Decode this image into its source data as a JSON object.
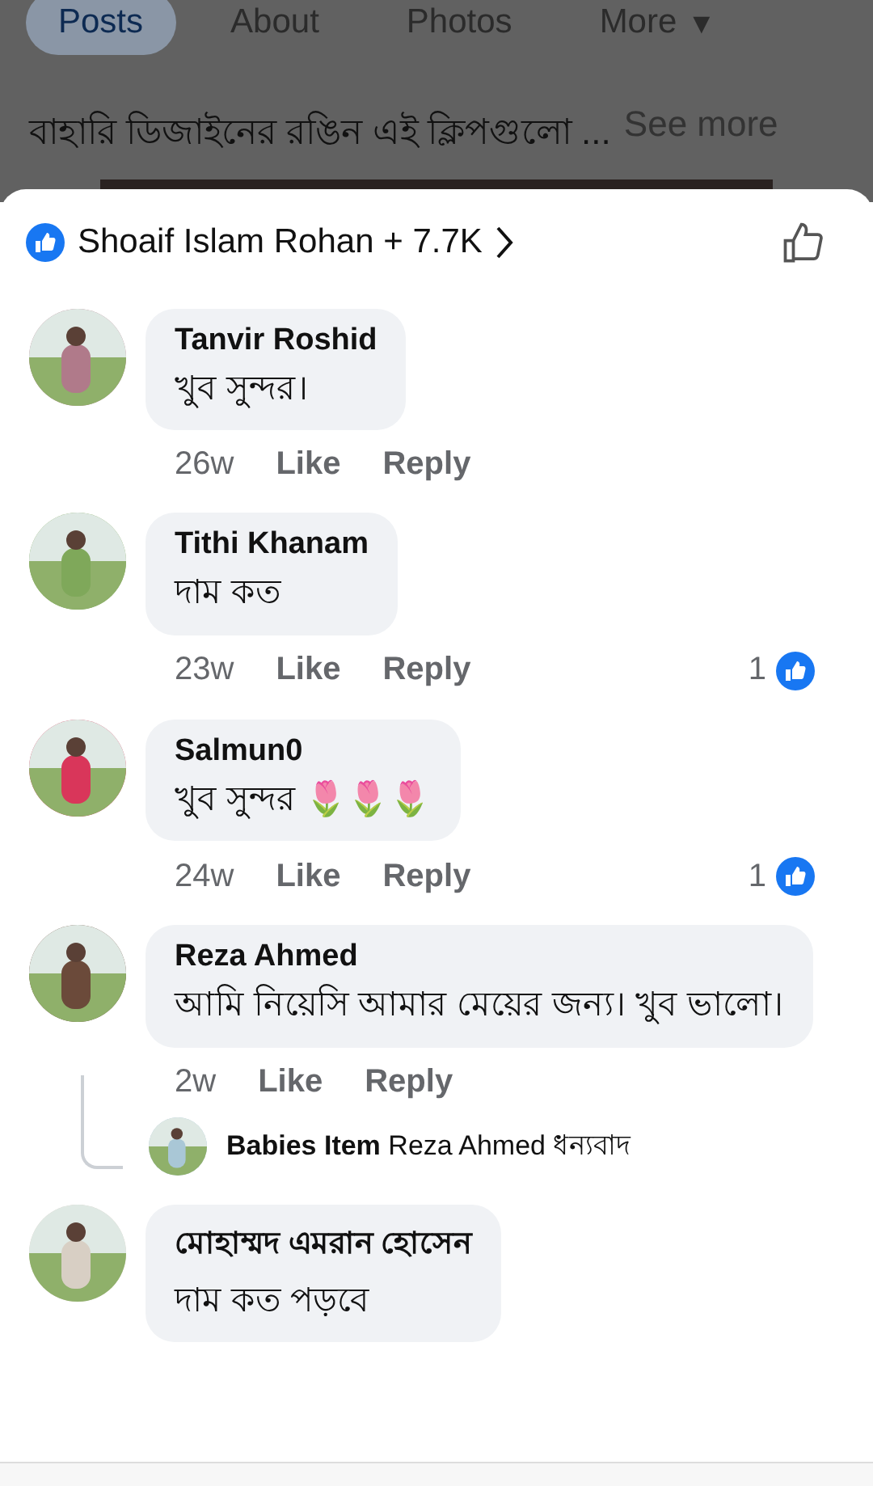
{
  "page_tabs": [
    {
      "label": "Posts",
      "selected": true
    },
    {
      "label": "About",
      "selected": false
    },
    {
      "label": "Photos",
      "selected": false
    },
    {
      "label": "More",
      "selected": false,
      "caret": "▾"
    }
  ],
  "post_text": "বাহারি ডিজাইনের রঙিন এই ক্লিপগুলো ...",
  "see_more": "See more",
  "reactions_header": {
    "summary": "Shoaif Islam Rohan + 7.7K"
  },
  "comments": [
    {
      "name": "Tanvir Roshid",
      "text": "খুব সুন্দর।",
      "time": "26w",
      "like": "Like",
      "reply": "Reply"
    },
    {
      "name": "Tithi Khanam",
      "text": "দাম কত",
      "time": "23w",
      "like": "Like",
      "reply": "Reply",
      "reaction_count": "1"
    },
    {
      "name": "Salmun0",
      "text": "খুব সুন্দর 🌷🌷🌷",
      "time": "24w",
      "like": "Like",
      "reply": "Reply",
      "reaction_count": "1"
    },
    {
      "name": "Reza Ahmed",
      "text": "আমি  নিয়েসি আমার  মেয়ের জন্য। খুব ভালো।",
      "time": "2w",
      "like": "Like",
      "reply": "Reply",
      "replies": [
        {
          "name": "Babies Item",
          "text": "Reza Ahmed ধন্যবাদ"
        }
      ]
    },
    {
      "name": "মোহাম্মদ এমরান হোসেন",
      "text": "দাম কত পড়বে"
    }
  ]
}
